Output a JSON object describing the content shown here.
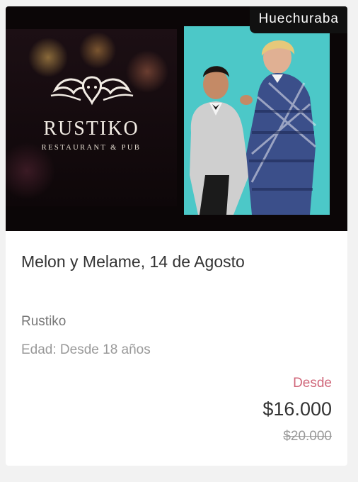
{
  "event": {
    "location_badge": "Huechuraba",
    "title": "Melon y Melame, 14 de Agosto",
    "venue": "Rustiko",
    "age": "Edad: Desde 18 años",
    "price_prefix": "Desde",
    "price": "$16.000",
    "original_price": "$20.000"
  },
  "image": {
    "logo_name": "RUSTIKO",
    "logo_sub": "RESTAURANT & PUB"
  },
  "colors": {
    "accent": "#d0677a",
    "badge_bg": "#111111",
    "photo_bg": "#4cc8c8"
  }
}
